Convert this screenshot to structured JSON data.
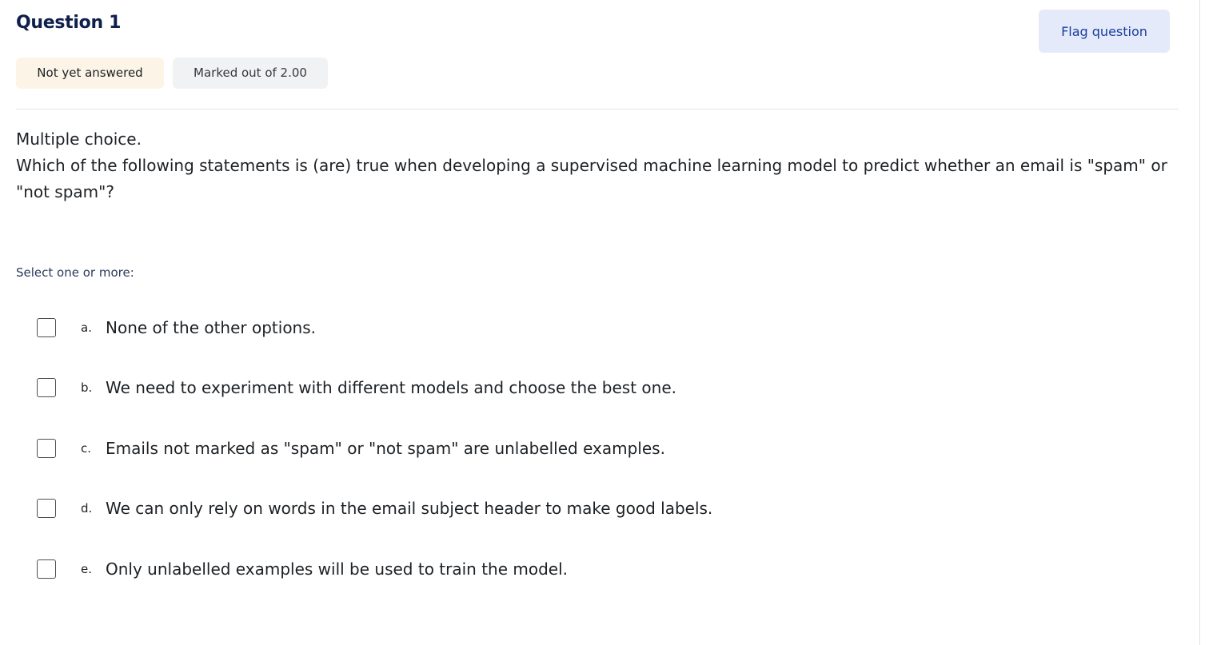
{
  "question": {
    "title": "Question 1",
    "flag_label": "Flag question",
    "state": "Not yet answered",
    "grade": "Marked out of 2.00",
    "type_text": "Multiple choice.",
    "body_text": "Which of the following statements is (are) true when developing a supervised machine learning model to predict whether an email is \"spam\" or \"not spam\"?",
    "prompt": "Select one or more:"
  },
  "options": [
    {
      "letter": "a.",
      "text": "None of the other options.",
      "checked": false
    },
    {
      "letter": "b.",
      "text": "We need to experiment with different models and choose the best one.",
      "checked": false
    },
    {
      "letter": "c.",
      "text": "Emails not marked as \"spam\" or \"not spam\" are unlabelled examples.",
      "checked": false
    },
    {
      "letter": "d.",
      "text": "We can only rely on words in the email subject header to make good labels.",
      "checked": false
    },
    {
      "letter": "e.",
      "text": "Only unlabelled examples will be used to train the model.",
      "checked": false
    }
  ],
  "colors": {
    "title": "#0f1f4b",
    "flag_bg": "#e4eafa",
    "flag_text": "#1a3d9e",
    "state_bg": "#fcf4e6",
    "grade_bg": "#f1f2f4"
  }
}
